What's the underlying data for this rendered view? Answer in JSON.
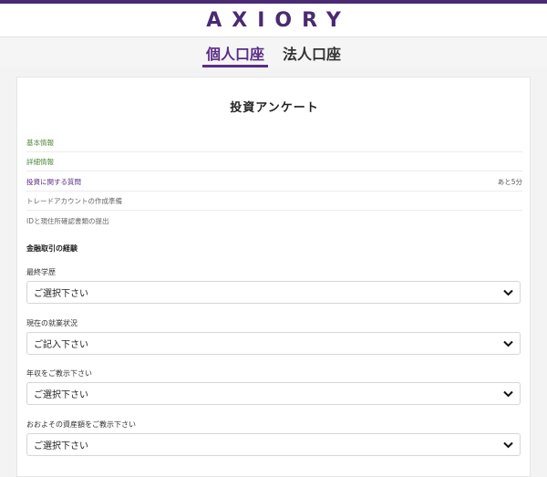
{
  "header": {
    "logo_text": "AXIORY",
    "accent_color": "#4a2a72"
  },
  "tabs": [
    {
      "label": "個人口座",
      "active": true
    },
    {
      "label": "法人口座",
      "active": false
    }
  ],
  "form": {
    "title": "投資アンケート",
    "steps": [
      {
        "label": "基本情報",
        "status": "done",
        "time": ""
      },
      {
        "label": "詳細情報",
        "status": "done",
        "time": ""
      },
      {
        "label": "投資に関する質問",
        "status": "current",
        "time": "あと5分"
      },
      {
        "label": "トレードアカウントの作成準備",
        "status": "pending",
        "time": ""
      },
      {
        "label": "IDと現住所確認書類の提出",
        "status": "pending",
        "time": ""
      }
    ],
    "section_heading": "金融取引の経験",
    "fields": [
      {
        "label": "最終学歴",
        "value": "ご選択下さい"
      },
      {
        "label": "現在の就業状況",
        "value": "ご記入下さい"
      },
      {
        "label": "年収をご教示下さい",
        "value": "ご選択下さい"
      },
      {
        "label": "おおよその資産額をご教示下さい",
        "value": "ご選択下さい"
      }
    ]
  }
}
